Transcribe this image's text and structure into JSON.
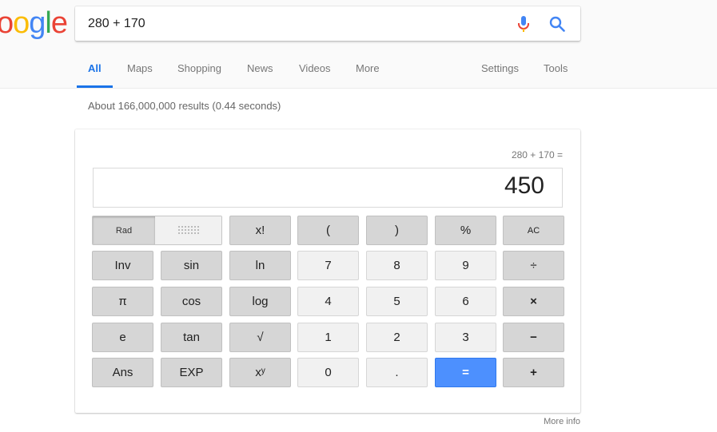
{
  "logo": {
    "visible_text": "ogle"
  },
  "search": {
    "query": "280 + 170"
  },
  "tabs": [
    {
      "label": "All",
      "active": true
    },
    {
      "label": "Maps"
    },
    {
      "label": "Shopping"
    },
    {
      "label": "News"
    },
    {
      "label": "Videos"
    },
    {
      "label": "More"
    },
    {
      "label": "Settings"
    },
    {
      "label": "Tools"
    }
  ],
  "result_stats": "About 166,000,000 results (0.44 seconds)",
  "calculator": {
    "expression": "280 + 170 =",
    "display": "450",
    "angle_mode": {
      "rad": "Rad"
    },
    "keys": {
      "fact": "x!",
      "lparen": "(",
      "rparen": ")",
      "percent": "%",
      "ac": "AC",
      "inv": "Inv",
      "sin": "sin",
      "ln": "ln",
      "n7": "7",
      "n8": "8",
      "n9": "9",
      "divide": "÷",
      "pi": "π",
      "cos": "cos",
      "log": "log",
      "n4": "4",
      "n5": "5",
      "n6": "6",
      "multiply": "×",
      "e": "e",
      "tan": "tan",
      "sqrt": "√",
      "n1": "1",
      "n2": "2",
      "n3": "3",
      "minus": "−",
      "ans": "Ans",
      "exp": "EXP",
      "pow": "xʸ",
      "n0": "0",
      "dot": ".",
      "equals": "=",
      "plus": "+"
    }
  },
  "more_info": "More info",
  "colors": {
    "accent": "#1a73e8",
    "equals_button": "#4d90fe"
  }
}
